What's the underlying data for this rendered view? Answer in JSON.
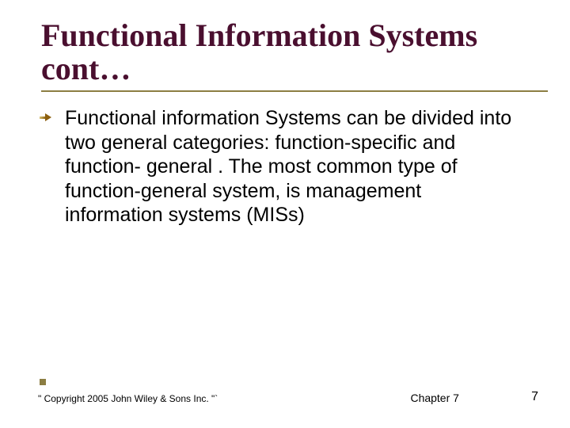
{
  "title": "Functional Information Systems cont…",
  "bullets": [
    "Functional information Systems can be divided into two general categories: function-specific and function- general . The most common type of function-general system, is management information systems (MISs)"
  ],
  "footer": {
    "copyright": "\" Copyright 2005 John Wiley & Sons Inc. \"`",
    "chapter": "Chapter 7",
    "page": "7"
  }
}
